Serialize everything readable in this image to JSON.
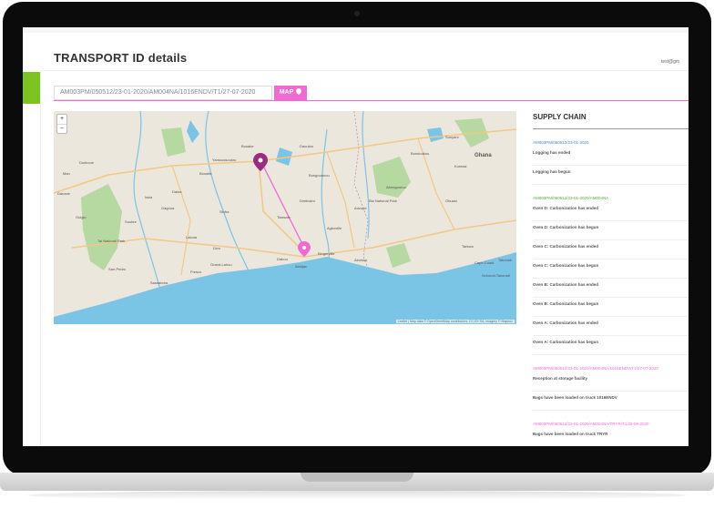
{
  "page": {
    "title": "TRANSPORT ID details",
    "user": "test@gm"
  },
  "transport": {
    "id_value": "AM003PM/050512/23-01-2020/AM004NA/1016ENDV/T1/27-07-2020",
    "map_button": "MAP"
  },
  "map": {
    "zoom_in": "+",
    "zoom_out": "−",
    "attribution": "Leaflet | Map data © OpenStreetMap contributors, CC-BY-SA, Imagery © Mapbox",
    "places": [
      "Man",
      "Danane",
      "Duekoue",
      "Guiglo",
      "Soubre",
      "Gagnoa",
      "Issia",
      "Daloa",
      "Bouafle",
      "Yamoussoukro",
      "Bouake",
      "Sinfra",
      "Divo",
      "Lakota",
      "San-Pedro",
      "Sassandra",
      "Fresco",
      "Grand-Lahou",
      "Dabou",
      "Abidjan",
      "Agboville",
      "Adzope",
      "Abengourou",
      "Dimbokro",
      "Bongouanou",
      "Daoukro",
      "Bondoukou",
      "Sunyani",
      "Kumasi",
      "Obuasi",
      "Ghana",
      "Takoradi",
      "Cape Coast",
      "Tarkwa",
      "Aboisso",
      "Tiassale",
      "Bingerville",
      "Sekondi-Takoradi",
      "Bia National Park",
      "Tai National Park"
    ],
    "colors": {
      "land": "#ece7dc",
      "water": "#7ac4e6",
      "green": "#b5d9a0",
      "road": "#f3c784",
      "route": "#f06ad3"
    }
  },
  "supply_chain": {
    "title": "SUPPLY CHAIN",
    "groups": [
      {
        "id": "AM003PM/050512/23-01-2020",
        "color": "#4a7fd6",
        "events": [
          "Logging has ended",
          "Logging has begun"
        ]
      },
      {
        "id": "AM003PM/050512/23-01-2020/AM004NA",
        "color": "#5aa832",
        "events": [
          "Oven D: Carbonization has ended",
          "Oven D: Carbonization has begun",
          "Oven C: Carbonization has ended",
          "Oven C: Carbonization has begun",
          "Oven B: Carbonization has ended",
          "Oven B: Carbonization has begun",
          "Oven A: Carbonization has ended",
          "Oven A: Carbonization has begun"
        ]
      },
      {
        "id": "AM003PM/050512/23-01-2020/AM004NA/1016ENDV/T1/27-07-2020",
        "color": "#f06ad3",
        "events": [
          "Reception at storage facility",
          "Bags have been loaded on truck 1016ENDV"
        ]
      },
      {
        "id": "AM003PM/050512/23-01-2020/AM004NA/TRYR/T1/28-08-2020",
        "color": "#f06ad3",
        "events": [
          "Bags have been loaded on truck TRYR"
        ]
      }
    ]
  }
}
